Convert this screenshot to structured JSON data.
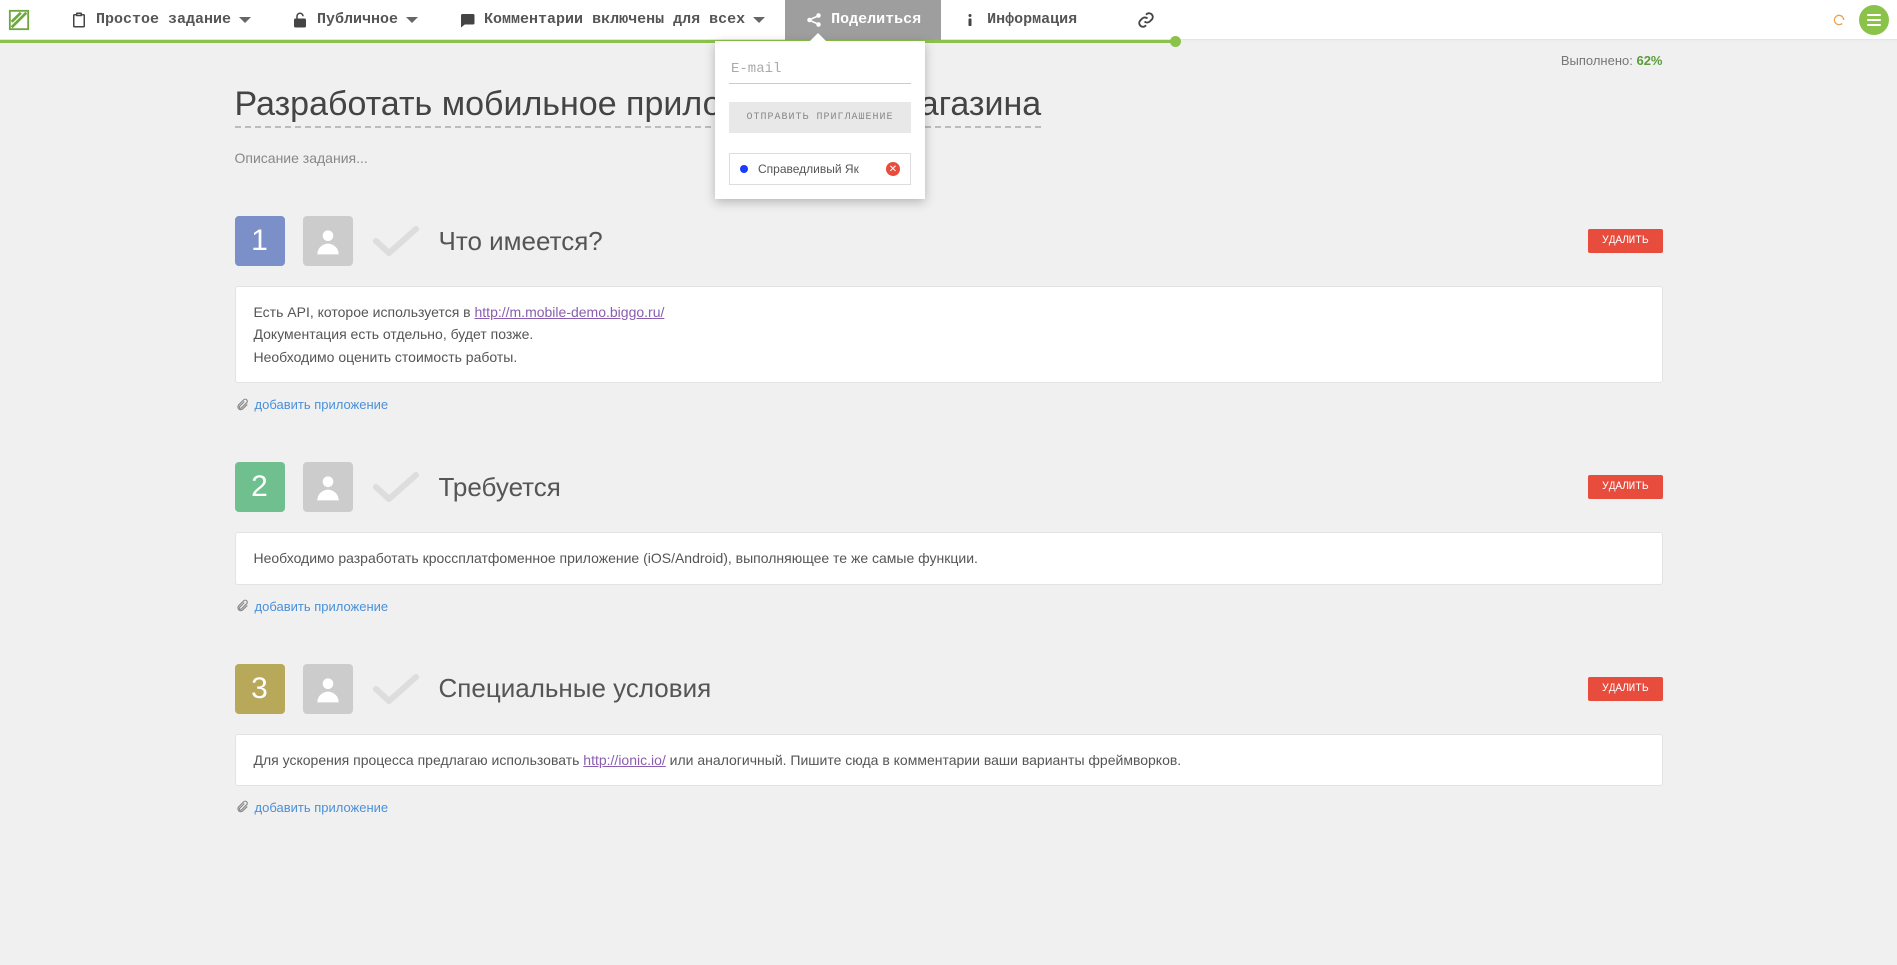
{
  "topbar": {
    "task_type": "Простое задание",
    "privacy": "Публичное",
    "comments": "Комментарии включены для всех",
    "share": "Поделиться",
    "info": "Информация"
  },
  "progress": {
    "label": "Выполнено:",
    "value": "62%",
    "percent": 62
  },
  "popover": {
    "email_placeholder": "E-mail",
    "send_label": "ОТПРАВИТЬ ПРИГЛАШЕНИЕ",
    "user_name": "Справедливый Як"
  },
  "page": {
    "title": "Разработать мобильное приложение для магазина",
    "description": "Описание задания..."
  },
  "buttons": {
    "delete": "УДАЛИТЬ",
    "add_attachment": "добавить приложение"
  },
  "steps": [
    {
      "num": "1",
      "title": "Что имеется?",
      "body_pre": "Есть API, которое используется в ",
      "body_link": "http://m.mobile-demo.biggo.ru/",
      "body_post": "\nДокументация есть отдельно, будет позже.\nНеобходимо оценить стоимость работы."
    },
    {
      "num": "2",
      "title": "Требуется",
      "body_pre": "Необходимо разработать кроссплатфоменное приложение (iOS/Android), выполняющее те же самые функции.",
      "body_link": "",
      "body_post": ""
    },
    {
      "num": "3",
      "title": "Специальные условия",
      "body_pre": "Для ускорения процесса предлагаю использовать ",
      "body_link": "http://ionic.io/",
      "body_post": " или аналогичный. Пишите сюда в комментарии ваши варианты фреймворков."
    }
  ]
}
